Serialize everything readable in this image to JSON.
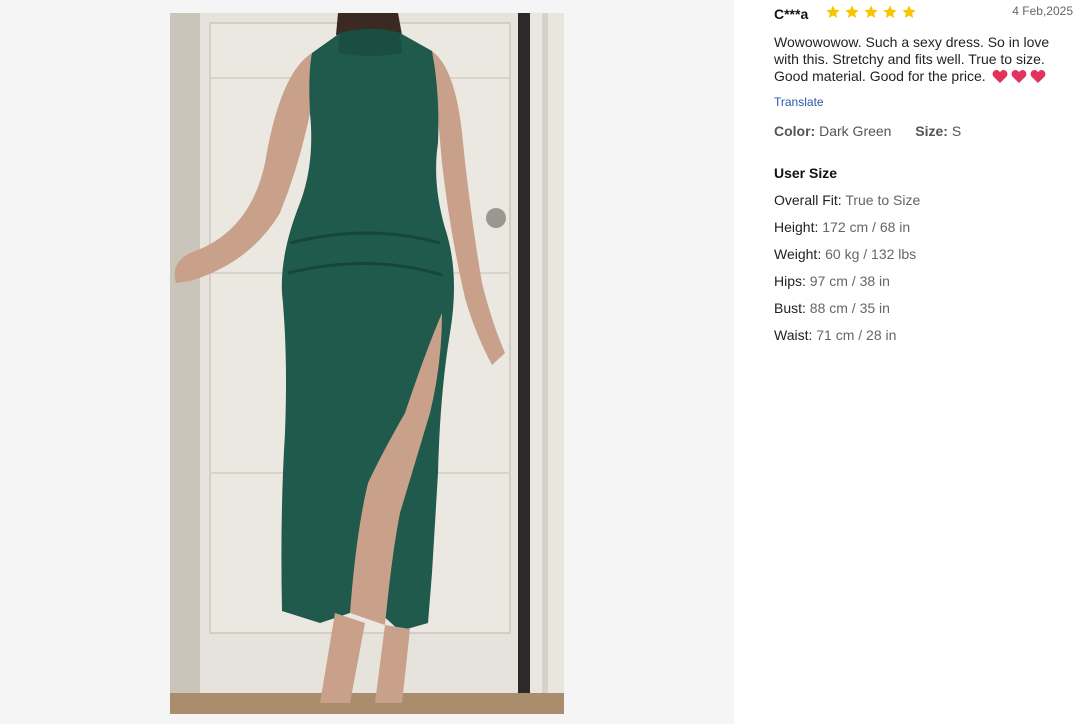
{
  "review": {
    "reviewer": "C***a",
    "rating": 5,
    "date": "4 Feb,2025",
    "text": "Wowowowow. Such a sexy dress. So in love with this. Stretchy and fits well. True to size. Good material. Good for the price.",
    "hearts": 3,
    "translate": "Translate",
    "color_label": "Color:",
    "color_value": "Dark Green",
    "size_label": "Size:",
    "size_value": "S"
  },
  "user_size": {
    "title": "User Size",
    "rows": [
      {
        "label": "Overall Fit:",
        "value": "True to Size"
      },
      {
        "label": "Height:",
        "value": "172 cm / 68 in"
      },
      {
        "label": "Weight:",
        "value": "60 kg / 132 lbs"
      },
      {
        "label": "Hips:",
        "value": "97 cm / 38 in"
      },
      {
        "label": "Bust:",
        "value": "88 cm / 35 in"
      },
      {
        "label": "Waist:",
        "value": "71 cm / 28 in"
      }
    ]
  },
  "colors": {
    "star": "#f7c600",
    "heart": "#e2335d",
    "link": "#2a58a6",
    "dress": "#1f5a4d"
  },
  "icons": {
    "star": "star-icon",
    "heart": "heart-icon"
  }
}
